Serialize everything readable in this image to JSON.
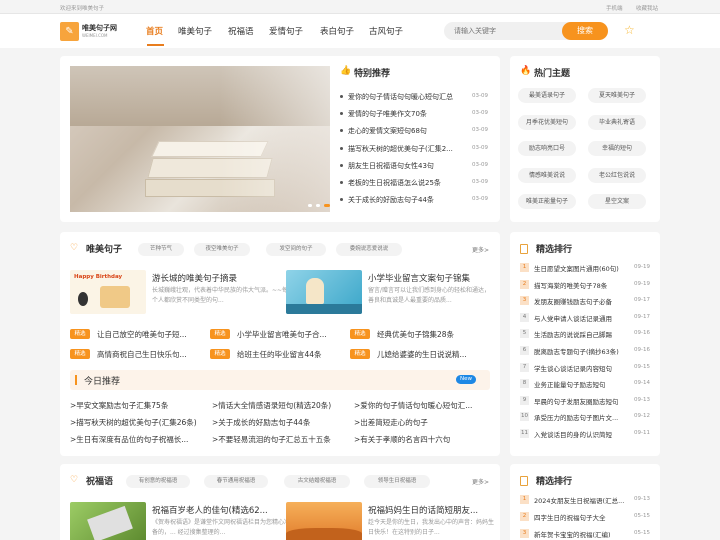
{
  "topbar": {
    "welcome": "欢迎来到唯美句子",
    "mobile": "手机端",
    "favorite": "收藏我站"
  },
  "logo": {
    "name": "唯美句子网",
    "url": "WEIMEI.COM"
  },
  "nav": [
    "首页",
    "唯美句子",
    "祝福语",
    "爱情句子",
    "表白句子",
    "古风句子"
  ],
  "search": {
    "placeholder": "请输入关键字",
    "button": "搜索"
  },
  "featured": {
    "title": "特别推荐",
    "items": [
      {
        "t": "爱你的句子情话句句暖心短句汇总",
        "d": "03-09"
      },
      {
        "t": "爱情的句子唯美作文70条",
        "d": "03-09"
      },
      {
        "t": "走心的爱情文案短句68句",
        "d": "03-09"
      },
      {
        "t": "描写秋天树的超优美句子(汇集2...",
        "d": "03-09"
      },
      {
        "t": "朋友生日祝福语句女性43句",
        "d": "03-09"
      },
      {
        "t": "老板的生日祝福语怎么说25条",
        "d": "03-09"
      },
      {
        "t": "关于成长的好励志句子44条",
        "d": "03-09"
      }
    ]
  },
  "hot": {
    "title": "热门主题",
    "tags": [
      "最美语录句子",
      "夏天唯美句子",
      "月季花优美短句",
      "毕业典礼寄语",
      "励志响亮口号",
      "幸福的短句",
      "情感唯美说说",
      "老公红包说说",
      "唯美正能量句子",
      "星空文案"
    ]
  },
  "weimei": {
    "title": "唯美句子",
    "pills": [
      "芒种节气",
      "夜空唯美句子",
      "发空间的句子",
      "委婉说恋爱说说"
    ],
    "more": "更多>",
    "features": [
      {
        "title": "游长城的唯美句子摘录",
        "desc": "长城巍峨壮观，代表着中华民族的伟大气派。~~每个人都欣赏不同类型的句..."
      },
      {
        "title": "小学毕业留言文案句子锦集",
        "desc": "留言/赠言可以让我们感到身心的轻松和通达，善良和真诚是人最重要的品质..."
      }
    ],
    "badge": "精选",
    "selected": [
      "让自己放空的唯美句子短...",
      "小学毕业留言唯美句子合...",
      "经典优美句子锦集28条",
      "高情商祝自己生日快乐句...",
      "给班主任的毕业留言44条",
      "儿媳给婆婆的生日说说精..."
    ],
    "today": {
      "title": "今日推荐",
      "new": "New"
    },
    "recs": [
      ">早安文案励志句子汇集75条",
      ">情话大全情感语录短句(精选20条)",
      ">爱你的句子情话句句暖心短句汇...",
      ">描写秋天树的超优美句子(汇集26条)",
      ">关于成长的好励志句子44条",
      ">出差简短走心的句子",
      ">生日有深度有品位的句子祝福长...",
      ">不要轻易流泪的句子汇总五十五条",
      ">有关于孝顺的名言四十六句"
    ]
  },
  "rank": {
    "title": "精选排行",
    "items": [
      {
        "t": "生日愿望文案图片通用(60句)",
        "d": "09-19"
      },
      {
        "t": "描写海棠的唯美句子78条",
        "d": "09-19"
      },
      {
        "t": "发朋友圈赚钱励志句子必备",
        "d": "09-17"
      },
      {
        "t": "与人党申请人谈话记录通用",
        "d": "09-17"
      },
      {
        "t": "生活励志的说说踩自己脚踢",
        "d": "09-16"
      },
      {
        "t": "脱离励志专题句子(摘抄63条)",
        "d": "09-16"
      },
      {
        "t": "学生谈心谈话记录内容短句",
        "d": "09-15"
      },
      {
        "t": "业务正能量句子励志短句",
        "d": "09-14"
      },
      {
        "t": "早晨的句子发朋友圈励志短句",
        "d": "09-13"
      },
      {
        "t": "承受压力的励志句子图片文...",
        "d": "09-12"
      },
      {
        "t": "入党谈话目的身的认识简短",
        "d": "09-11"
      }
    ]
  },
  "bless": {
    "title": "祝福语",
    "pills": [
      "有创意的祝福语",
      "春节通用祝福语",
      "古文结婚祝福语",
      "领导生日祝福语"
    ],
    "more": "更多>",
    "features": [
      {
        "title": "祝福百岁老人的佳句(精选62...",
        "desc": "《贺寿祝福语》是谦堂作文网祝福语栏目为您精心准备的，... 经过搜集整理的..."
      },
      {
        "title": "祝福妈妈生日的话简短朋友...",
        "desc": "趁今天是你的生日，我发出心中的声音：妈妈生日快乐！在这特别的日子..."
      }
    ]
  },
  "rank2": {
    "title": "精选排行",
    "items": [
      {
        "t": "2024女朋友生日祝福语(汇总...",
        "d": "09-13"
      },
      {
        "t": "四字生日的祝福句子大全",
        "d": "05-15"
      },
      {
        "t": "新年贺卡宝宝的祝福(汇编)",
        "d": "05-15"
      }
    ]
  }
}
